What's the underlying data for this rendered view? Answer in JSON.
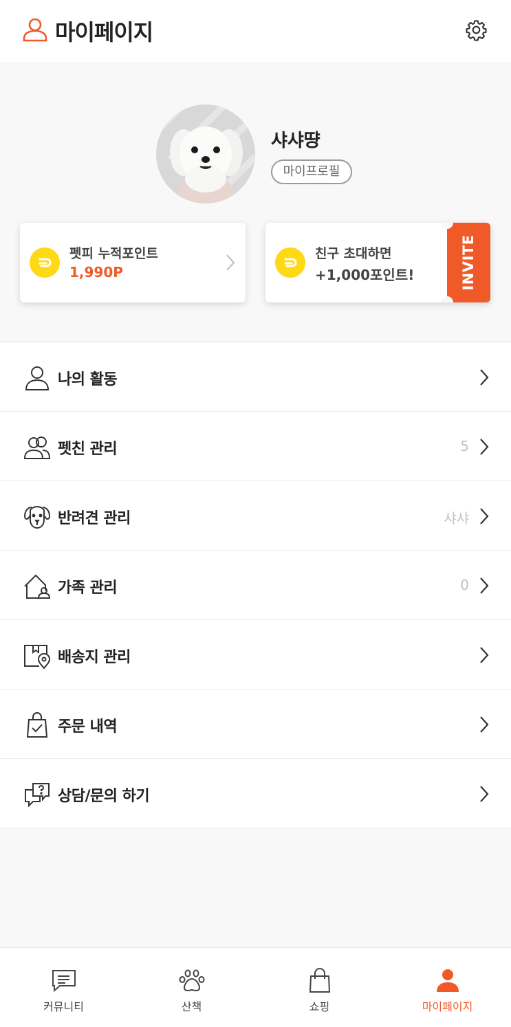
{
  "header": {
    "title": "마이페이지",
    "settings_icon": "gear-icon",
    "title_icon": "person-icon"
  },
  "profile": {
    "nickname": "샤샤땽",
    "profile_button": "마이프로필",
    "avatar": "dog-avatar"
  },
  "cards": {
    "points": {
      "label": "펫피 누적포인트",
      "value": "1,990P"
    },
    "invite": {
      "line1": "친구 초대하면",
      "line2": "+1,000포인트!",
      "tab": "INVITE"
    }
  },
  "menu": [
    {
      "label": "나의 활동",
      "count": "",
      "icon": "person-icon"
    },
    {
      "label": "펫친 관리",
      "count": "5",
      "icon": "friends-icon"
    },
    {
      "label": "반려견 관리",
      "count": "샤샤",
      "icon": "dog-face-icon"
    },
    {
      "label": "가족 관리",
      "count": "0",
      "icon": "home-person-icon"
    },
    {
      "label": "배송지 관리",
      "count": "",
      "icon": "delivery-location-icon"
    },
    {
      "label": "주문 내역",
      "count": "",
      "icon": "shopping-bag-check-icon"
    },
    {
      "label": "상담/문의 하기",
      "count": "",
      "icon": "question-chat-icon"
    }
  ],
  "bottom_nav": [
    {
      "label": "커뮤니티",
      "icon": "chat-icon",
      "active": false
    },
    {
      "label": "산책",
      "icon": "paw-icon",
      "active": false
    },
    {
      "label": "쇼핑",
      "icon": "bag-icon",
      "active": false
    },
    {
      "label": "마이페이지",
      "icon": "person-icon",
      "active": true
    }
  ],
  "colors": {
    "accent": "#f05a28",
    "coin": "#ffd816"
  }
}
